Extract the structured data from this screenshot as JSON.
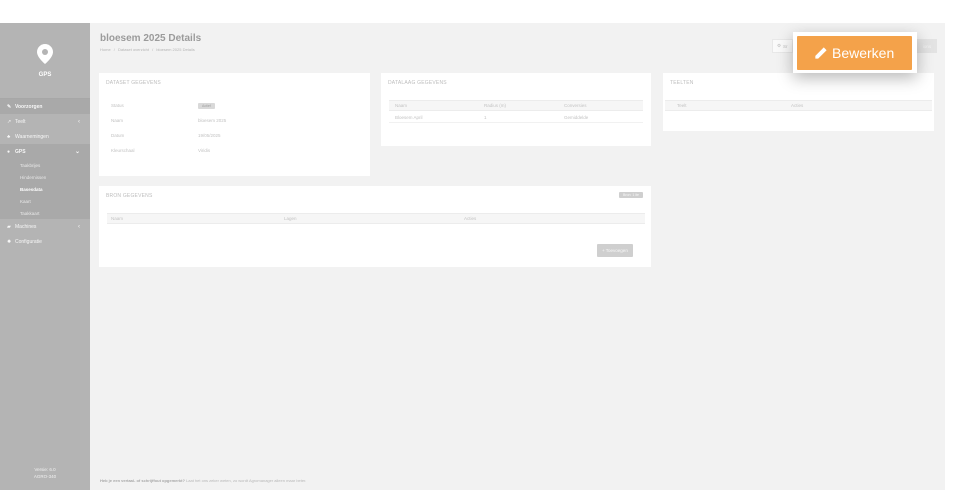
{
  "sidebar": {
    "brand": "GPS",
    "items": [
      {
        "label": "Voorzorgen",
        "icon": "wrench-icon",
        "active": true,
        "chevron": ""
      },
      {
        "label": "Teelt",
        "icon": "chart-icon",
        "chevron": "‹"
      },
      {
        "label": "Waarnemingen",
        "icon": "users-icon",
        "chevron": ""
      },
      {
        "label": "GPS",
        "icon": "map-marker-icon",
        "chevron": "⌄"
      },
      {
        "label": "Machines",
        "icon": "tractor-icon",
        "chevron": "‹"
      },
      {
        "label": "Configuratie",
        "icon": "gear-icon",
        "chevron": ""
      }
    ],
    "gps_sub": [
      "Taakbrijes",
      "Hindernissen",
      "Basesdata",
      "Kaart",
      "Taakkaart"
    ],
    "version_line1": "Versie: 6.0",
    "version_line2": "AGRO-340"
  },
  "header": {
    "title": "bloesem 2025 Details",
    "breadcrumb": [
      "Home",
      "/",
      "Dataset overzicht",
      "/",
      "bloesem 2025 Details"
    ],
    "small_button": "Sr",
    "right_button": "ions"
  },
  "dataset": {
    "title": "DATASET GEGEVENS",
    "rows": [
      {
        "key": "Status",
        "value": "Actief",
        "badge": true
      },
      {
        "key": "Naam",
        "value": "bloesem 2025"
      },
      {
        "key": "Datum",
        "value": "19/05/2025"
      },
      {
        "key": "Kleurschaal",
        "value": "Viridis"
      }
    ]
  },
  "overlay": {
    "title": "DATALAAG GEGEVENS",
    "headers": [
      "Naam",
      "Radius (m)",
      "Conversies"
    ],
    "rows": [
      [
        "Bloesem April",
        "1",
        "Gemiddelde"
      ]
    ]
  },
  "teelten": {
    "title": "TEELTEN",
    "headers": [
      "Teelt",
      "Acties"
    ]
  },
  "bron": {
    "title": "BRON GEGEVENS",
    "tag": "Bron: 1 ite",
    "headers": [
      "Naam",
      "Lagen",
      "Acties"
    ],
    "add_label": "+ Toevoegen"
  },
  "footer": {
    "question": "Heb je een vertaal- of schrijffout opgemerkt?",
    "text": "Laat het ons zeker weten, zo wordt Agromanager alleen maar beter."
  },
  "edit": {
    "label": "Bewerken"
  },
  "colors": {
    "accent": "#f4a24a",
    "sidebar": "#b4b4b4"
  }
}
